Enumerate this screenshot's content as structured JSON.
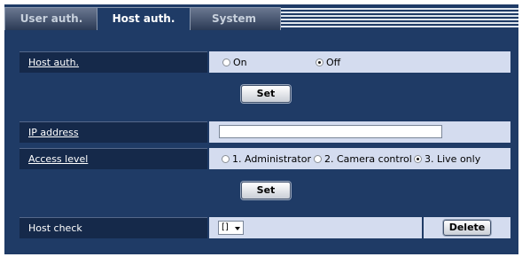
{
  "tabs": [
    {
      "label": "User auth."
    },
    {
      "label": "Host auth."
    },
    {
      "label": "System"
    }
  ],
  "host_auth": {
    "label": "Host auth.",
    "options": [
      "On",
      "Off"
    ],
    "selected": "Off"
  },
  "set_button_label": "Set",
  "ip_address": {
    "label": "IP address",
    "value": ""
  },
  "access_level": {
    "label": "Access level",
    "options": [
      "1. Administrator",
      "2. Camera control",
      "3. Live only"
    ],
    "selected": "3. Live only"
  },
  "host_check": {
    "label": "Host check",
    "select_value": "[]",
    "delete_label": "Delete"
  }
}
